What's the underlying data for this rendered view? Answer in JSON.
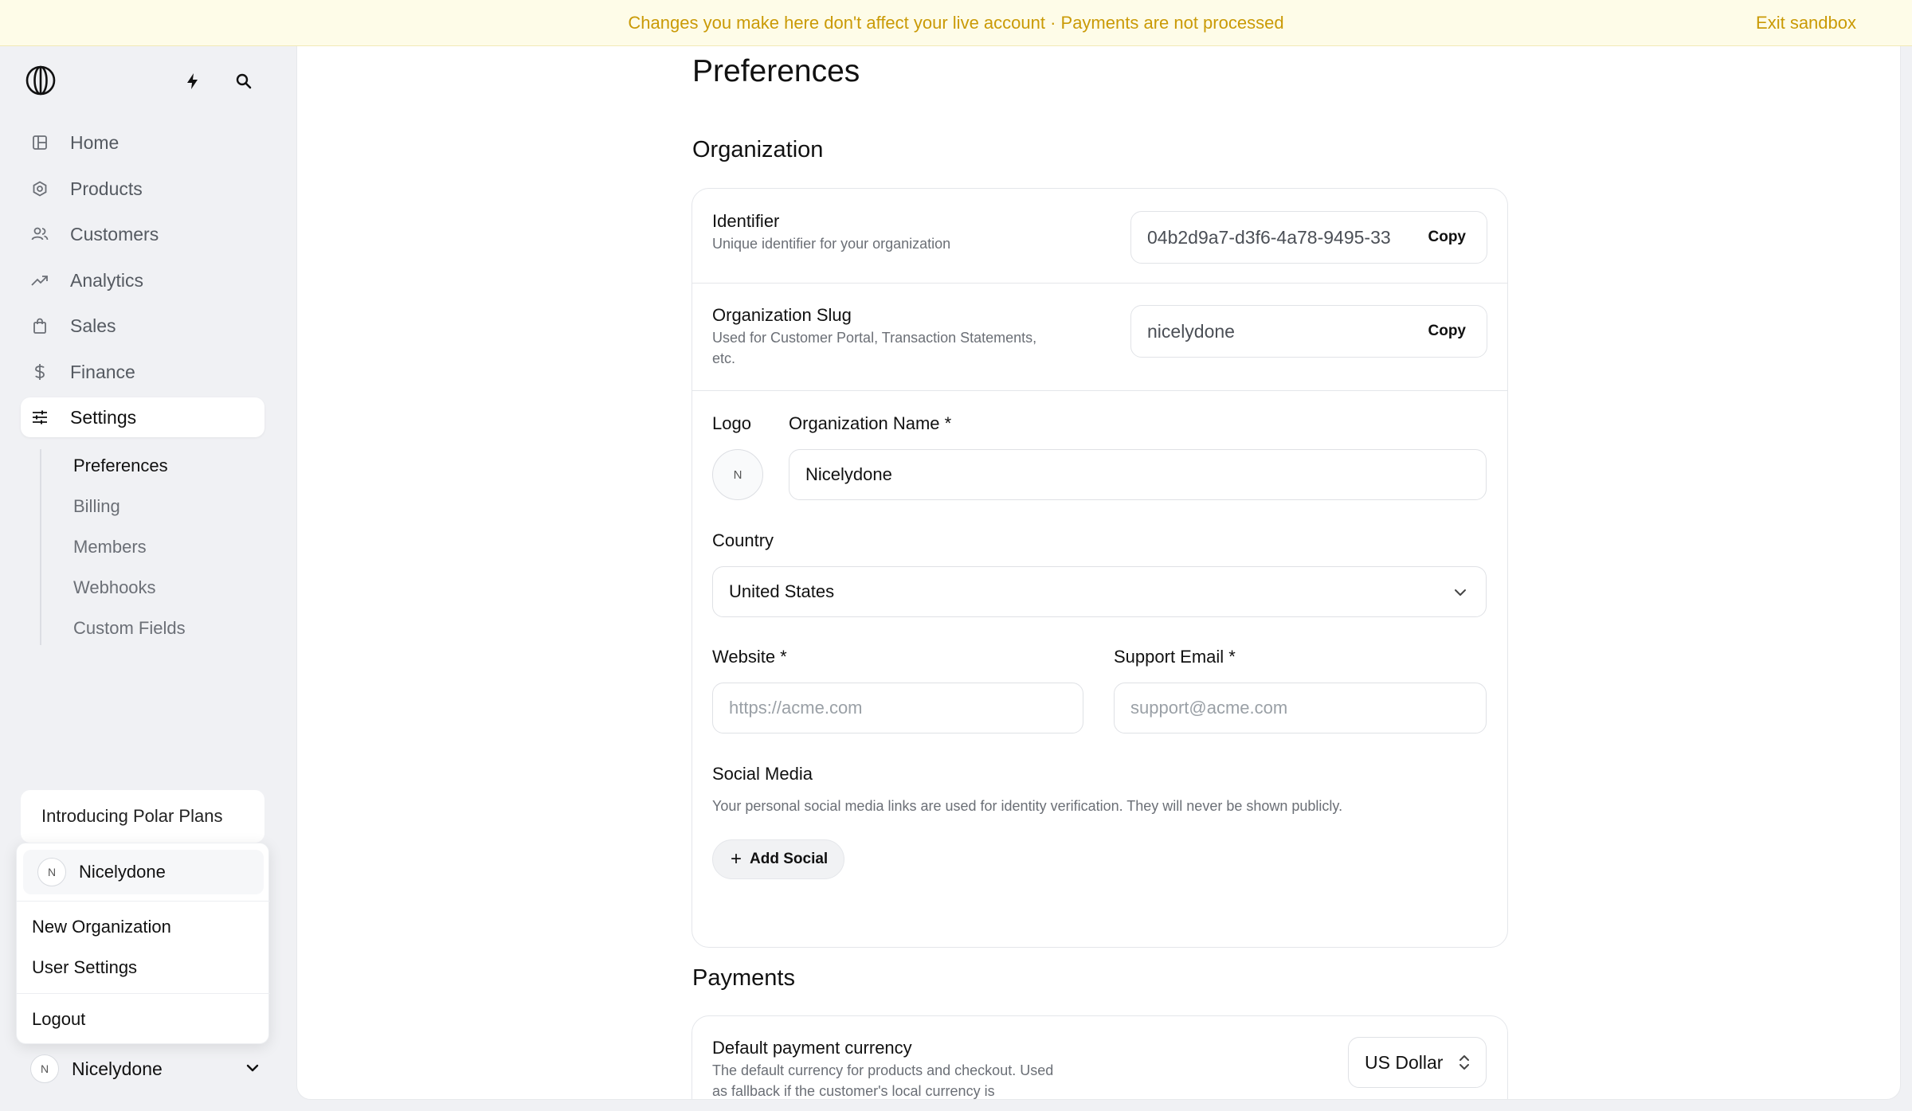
{
  "banner": {
    "message": "Changes you make here don't affect your live account · Payments are not processed",
    "exit": "Exit sandbox"
  },
  "sidebar": {
    "logo_icon": "polar-logo-icon",
    "nav": [
      {
        "label": "Home",
        "icon": "dashboard-icon"
      },
      {
        "label": "Products",
        "icon": "hexagon-icon"
      },
      {
        "label": "Customers",
        "icon": "users-icon"
      },
      {
        "label": "Analytics",
        "icon": "trend-icon"
      },
      {
        "label": "Sales",
        "icon": "bag-icon"
      },
      {
        "label": "Finance",
        "icon": "dollar-icon"
      },
      {
        "label": "Settings",
        "icon": "sliders-icon"
      }
    ],
    "subnav": [
      "Preferences",
      "Billing",
      "Members",
      "Webhooks",
      "Custom Fields"
    ],
    "promo": "Introducing Polar Plans",
    "org_menu": {
      "current_initial": "N",
      "current_name": "Nicelydone",
      "new_org": "New Organization",
      "user_settings": "User Settings",
      "logout": "Logout"
    },
    "footer": {
      "initial": "N",
      "name": "Nicelydone"
    }
  },
  "main": {
    "title": "Preferences",
    "organization": {
      "heading": "Organization",
      "identifier": {
        "title": "Identifier",
        "desc": "Unique identifier for your organization",
        "value": "04b2d9a7-d3f6-4a78-9495-33",
        "copy": "Copy"
      },
      "slug": {
        "title": "Organization Slug",
        "desc": "Used for Customer Portal, Transaction Statements, etc.",
        "value": "nicelydone",
        "copy": "Copy"
      },
      "logo_label": "Logo",
      "logo_initial": "N",
      "name_label": "Organization Name *",
      "name_value": "Nicelydone",
      "country_label": "Country",
      "country_value": "United States",
      "website_label": "Website *",
      "website_placeholder": "https://acme.com",
      "support_label": "Support Email *",
      "support_placeholder": "support@acme.com",
      "social_label": "Social Media",
      "social_desc": "Your personal social media links are used for identity verification. They will never be shown publicly.",
      "add_social": "Add Social"
    },
    "payments": {
      "heading": "Payments",
      "currency_title": "Default payment currency",
      "currency_desc": "The default currency for products and checkout. Used as fallback if the customer's local currency is",
      "currency_value": "US Dollar"
    }
  }
}
